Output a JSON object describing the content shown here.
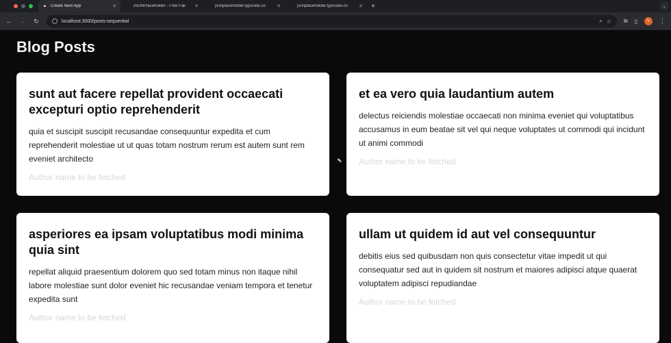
{
  "browser": {
    "tabs": [
      {
        "title": "Create Next App",
        "active": true
      },
      {
        "title": "JSONPlaceholder - Free Fak",
        "active": false
      },
      {
        "title": "jsonplaceholder.typicode.co",
        "active": false
      },
      {
        "title": "jsonplaceholder.typicode.co",
        "active": false
      }
    ],
    "url": "localhost:3000/posts-sequential",
    "profile_initial": "V"
  },
  "page": {
    "title": "Blog Posts"
  },
  "posts": [
    {
      "title": "sunt aut facere repellat provident occaecati excepturi optio reprehenderit",
      "body": "quia et suscipit suscipit recusandae consequuntur expedita et cum reprehenderit molestiae ut ut quas totam nostrum rerum est autem sunt rem eveniet architecto",
      "author": "Author name to be fetched"
    },
    {
      "title": "et ea vero quia laudantium autem",
      "body": "delectus reiciendis molestiae occaecati non minima eveniet qui voluptatibus accusamus in eum beatae sit vel qui neque voluptates ut commodi qui incidunt ut animi commodi",
      "author": "Author name to be fetched"
    },
    {
      "title": "asperiores ea ipsam voluptatibus modi minima quia sint",
      "body": "repellat aliquid praesentium dolorem quo sed totam minus non itaque nihil labore molestiae sunt dolor eveniet hic recusandae veniam tempora et tenetur expedita sunt",
      "author": "Author name to be fetched"
    },
    {
      "title": "ullam ut quidem id aut vel consequuntur",
      "body": "debitis eius sed quibusdam non quis consectetur vitae impedit ut qui consequatur sed aut in quidem sit nostrum et maiores adipisci atque quaerat voluptatem adipisci repudiandae",
      "author": "Author name to be fetched"
    }
  ]
}
